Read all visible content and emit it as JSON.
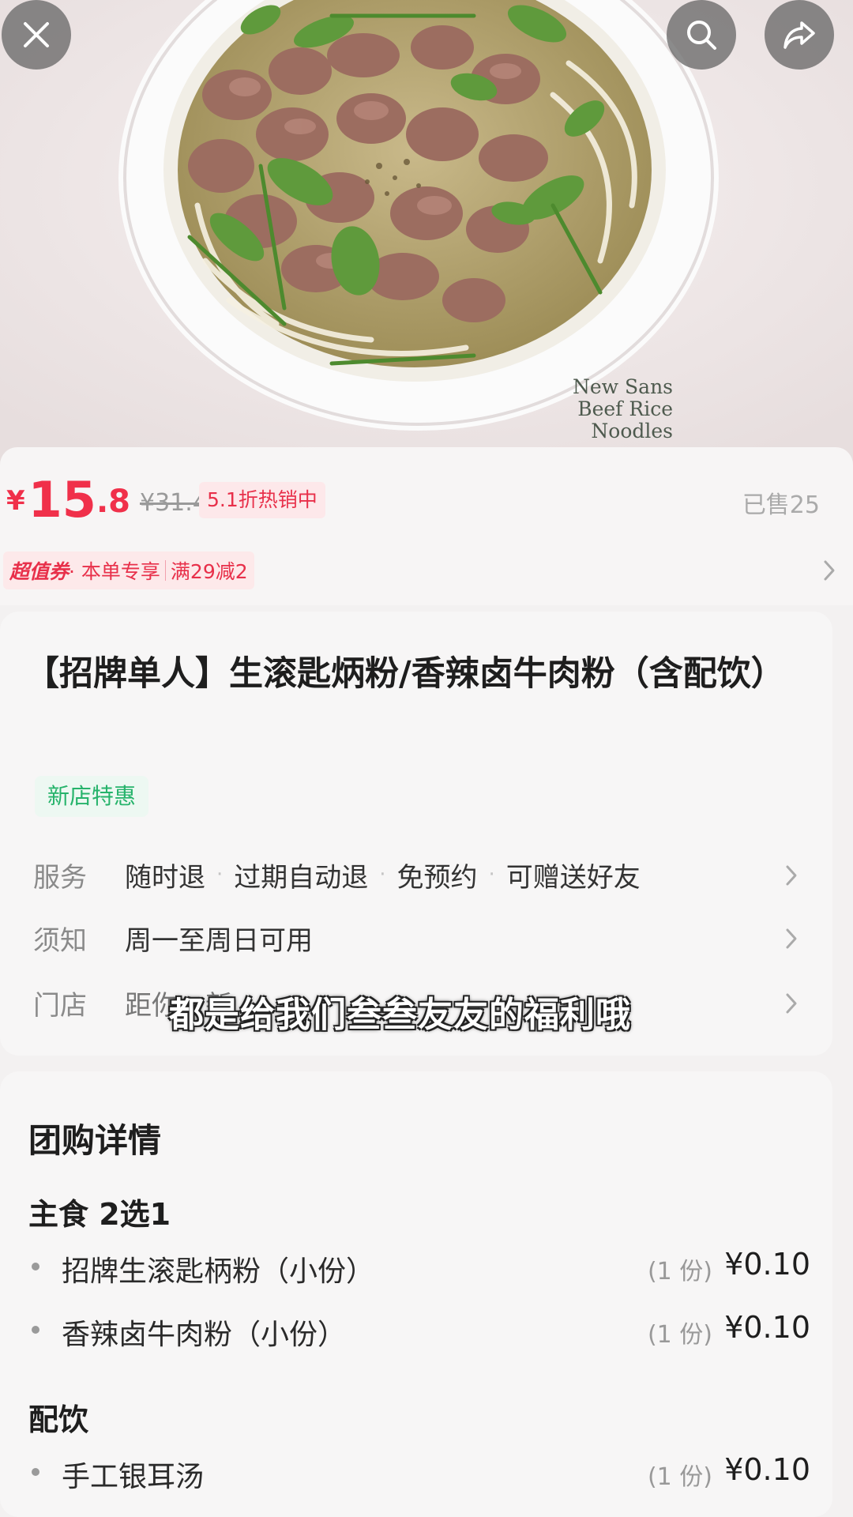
{
  "hero": {
    "caption_lines": [
      "New Sans",
      "Beef Rice",
      "Noodles"
    ],
    "icons": {
      "close": "close-icon",
      "search": "search-icon",
      "share": "share-icon"
    }
  },
  "price": {
    "currency": "¥",
    "integer": "15",
    "decimal": ".8",
    "original": "¥31.4",
    "discount_tag": "5.1折热销中",
    "sold": "已售25"
  },
  "coupon": {
    "brand": "超值券",
    "scope": "· 本单专享",
    "rule": "满29减2"
  },
  "deal": {
    "title": "【招牌单人】生滚匙炳粉/香辣卤牛肉粉（含配饮）",
    "tag": "新店特惠"
  },
  "info": {
    "service_label": "服务",
    "service_items": [
      "随时退",
      "过期自动退",
      "免预约",
      "可赠送好友"
    ],
    "notice_label": "须知",
    "notice_value": "周一至周日可用",
    "store_label": "门店",
    "store_value": "距你…新…"
  },
  "subtitle": "都是给我们叁叁友友的福利哦",
  "details": {
    "title": "团购详情",
    "sections": [
      {
        "heading": "主食 2选1",
        "items": [
          {
            "name": "招牌生滚匙柄粉（小份）",
            "qty": "(1 份)",
            "price": "¥0.10"
          },
          {
            "name": "香辣卤牛肉粉（小份）",
            "qty": "(1 份)",
            "price": "¥0.10"
          }
        ]
      },
      {
        "heading": "配饮",
        "items": [
          {
            "name": "手工银耳汤",
            "qty": "(1 份)",
            "price": "¥0.10"
          }
        ]
      }
    ]
  },
  "colors": {
    "price_red": "#f0304a",
    "tag_green": "#26b36b",
    "page_bg": "#f3f1f1"
  }
}
